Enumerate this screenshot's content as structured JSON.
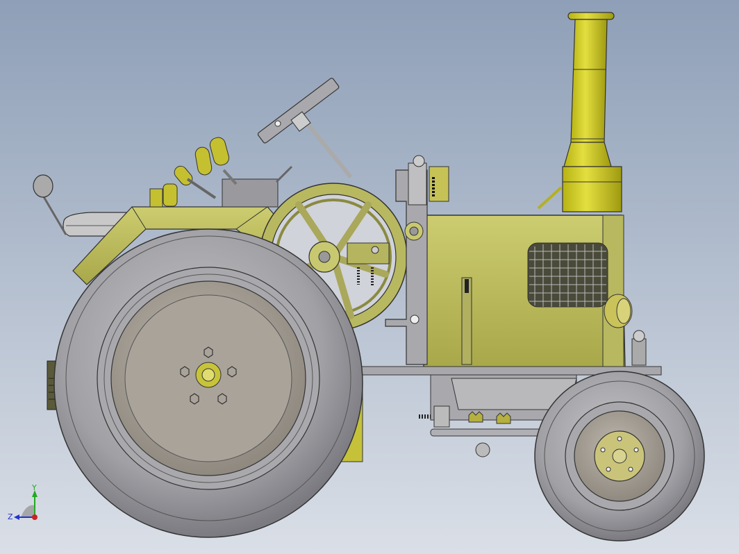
{
  "viewport": {
    "scene": "tractor-model",
    "background_top": "#8fa0b8",
    "background_bottom": "#d8dde6"
  },
  "colors": {
    "olive": "#b9b95a",
    "olive_dark": "#8a8a3a",
    "yellow": "#c9c420",
    "tire": "#9a9a9e",
    "rim": "#a8a39e",
    "steel": "#a8a8ac",
    "outline": "#2a2a2a"
  },
  "triad": {
    "y_label": "Y",
    "z_label": "Z"
  }
}
